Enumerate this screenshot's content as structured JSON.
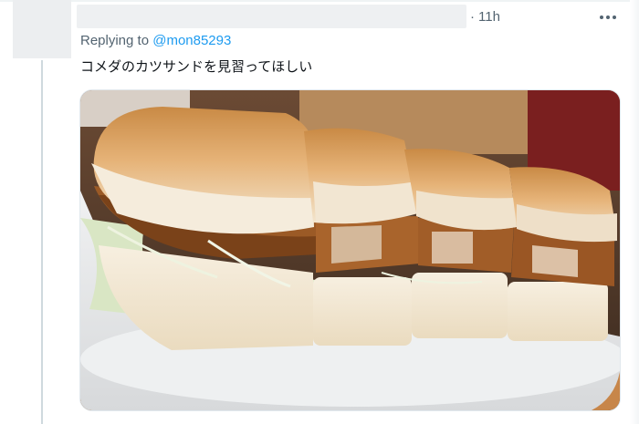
{
  "tweet": {
    "separator": "·",
    "time": "11h",
    "replying_prefix": "Replying to",
    "replying_handle": "@mon85293",
    "text": "コメダのカツサンドを見習ってほしい",
    "media_icon": "photo-of-katsu-sandwich"
  },
  "colors": {
    "link": "#1d9bf0",
    "secondary_text": "#536471",
    "primary_text": "#0f1419",
    "thread_line": "#cfd9de"
  }
}
